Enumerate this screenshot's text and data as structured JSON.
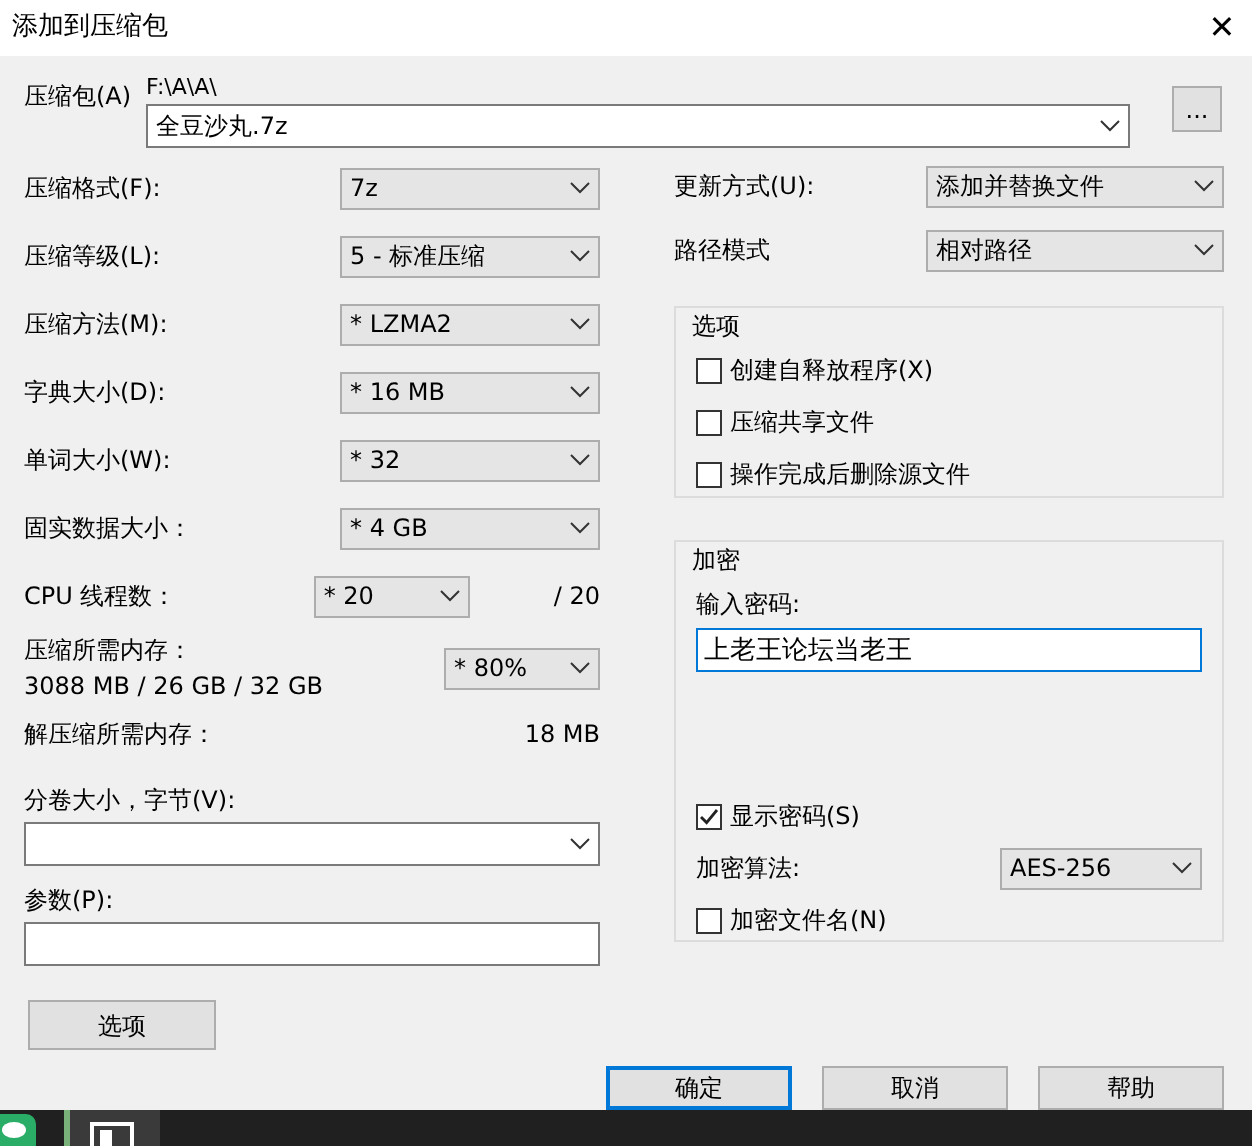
{
  "window": {
    "title": "添加到压缩包",
    "close": "✕"
  },
  "archive": {
    "label": "压缩包(A)",
    "path": "F:\\A\\A\\",
    "value": "全豆沙丸.7z",
    "browse": "..."
  },
  "left_settings": [
    {
      "label": "压缩格式(F):",
      "value": "7z"
    },
    {
      "label": "压缩等级(L):",
      "value": "5 - 标准压缩"
    },
    {
      "label": "压缩方法(M):",
      "value": "* LZMA2"
    },
    {
      "label": "字典大小(D):",
      "value": "* 16 MB"
    },
    {
      "label": "单词大小(W):",
      "value": "* 32"
    },
    {
      "label": "固实数据大小：",
      "value": "* 4 GB"
    },
    {
      "label": "CPU 线程数：",
      "value": "* 20",
      "suffix": "/ 20"
    }
  ],
  "memory": {
    "label": "压缩所需内存：",
    "usage": "3088 MB / 26 GB / 32 GB",
    "value": "* 80%"
  },
  "decompress_memory": {
    "label": "解压缩所需内存：",
    "value": "18 MB"
  },
  "split": {
    "label": "分卷大小，字节(V):"
  },
  "parameters": {
    "label": "参数(P):"
  },
  "options_button": "选项",
  "right_settings": [
    {
      "label": "更新方式(U):",
      "value": "添加并替换文件"
    },
    {
      "label": "路径模式",
      "value": "相对路径"
    }
  ],
  "options_group": {
    "title": "选项",
    "items": [
      {
        "label": "创建自释放程序(X)",
        "checked": false
      },
      {
        "label": "压缩共享文件",
        "checked": false
      },
      {
        "label": "操作完成后删除源文件",
        "checked": false
      }
    ]
  },
  "encryption": {
    "title": "加密",
    "password_label": "输入密码:",
    "password": "上老王论坛当老王",
    "show_password": {
      "label": "显示密码(S)",
      "checked": true
    },
    "method_label": "加密算法:",
    "method": "AES-256",
    "encrypt_names": {
      "label": "加密文件名(N)",
      "checked": false
    }
  },
  "buttons": [
    {
      "label": "确定",
      "default": true
    },
    {
      "label": "取消",
      "default": false
    },
    {
      "label": "帮助",
      "default": false
    }
  ]
}
